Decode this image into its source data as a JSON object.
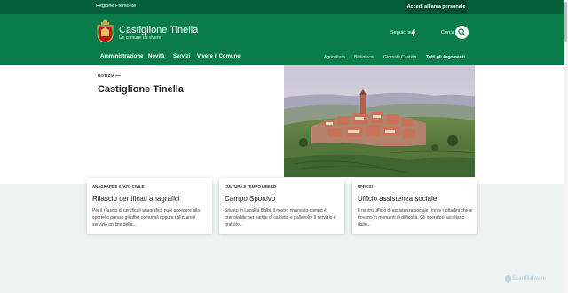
{
  "topbar": {
    "region": "Regione Piemonte",
    "login": "Accedi all'area personale"
  },
  "brand": {
    "title": "Castiglione Tinella",
    "subtitle": "Un comune da vivere"
  },
  "social": {
    "label": "Seguici su",
    "icon": "facebook-icon"
  },
  "search": {
    "label": "Cerca",
    "icon": "search-icon"
  },
  "nav": {
    "primary": [
      "Amministrazione",
      "Novità",
      "Servizi",
      "Vivere il Comune"
    ],
    "secondary": [
      "Agricoltura",
      "Biblioteca",
      "Giornale Castiòn",
      "Tutti gli Argomenti"
    ]
  },
  "hero": {
    "kicker": "NOTIZIA",
    "title": "Castiglione Tinella"
  },
  "cards": [
    {
      "category": "ANAGRAFE E STATO CIVILE",
      "title": "Rilascio certificati anagrafici",
      "text": "Per il rilascio di certificati anagrafici, puoi accedere allo sportello presso gli uffici comunali oppure utilizzare il servizio on-line della..."
    },
    {
      "category": "CULTURA E TEMPO LIBERO",
      "title": "Campo Sportivo",
      "text": "Situato in Località Balbi, il nostro rinnovato campo è prenotabile per partite di calcetto e pallavolo. Il servizio è gratuito..."
    },
    {
      "category": "UFFICIO",
      "title": "Ufficio assistenza sociale",
      "text": "Il nostro ufficio di assistenza sociale riceve i cittadini che si trovano in momenti di difficoltà. Gli operatori ascoltano dalle..."
    }
  ],
  "watermark": "ScanMalware",
  "colors": {
    "brand_green": "#0a7c4a",
    "topbar_green": "#06603a",
    "login_green": "#034d2e"
  }
}
